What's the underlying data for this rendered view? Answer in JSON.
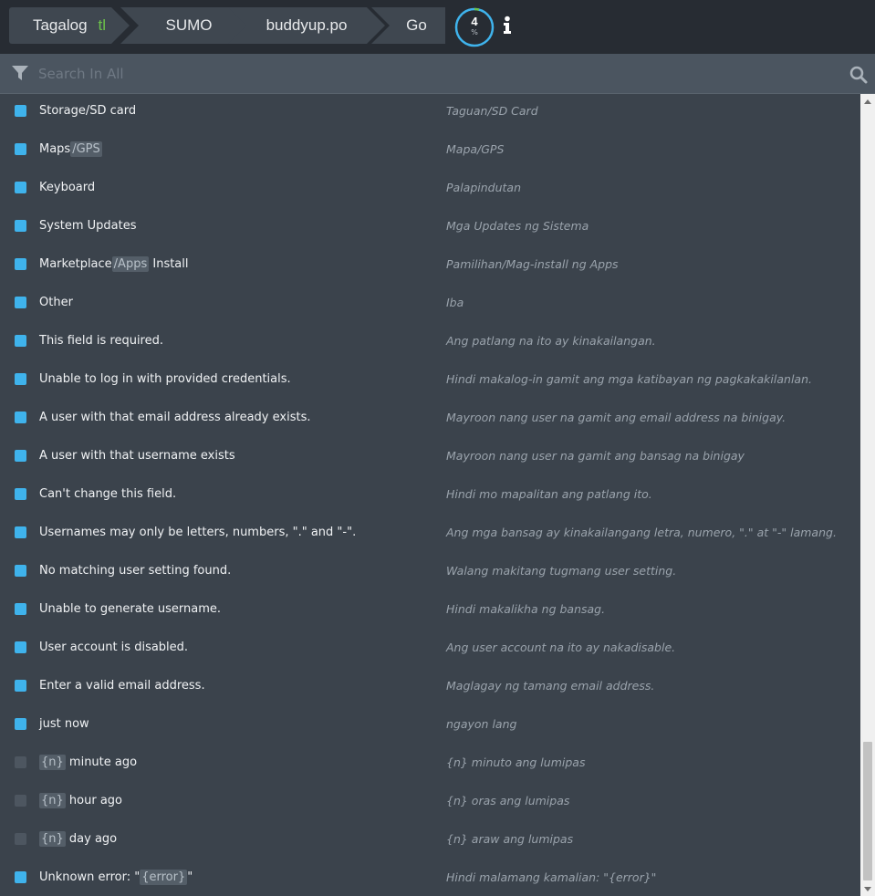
{
  "breadcrumb": {
    "language": "Tagalog",
    "language_code": "tl",
    "project": "SUMO",
    "file": "buddyup.po",
    "go_label": "Go"
  },
  "progress": {
    "value": "4",
    "unit": "%",
    "accent_color": "#3fb3ec"
  },
  "search": {
    "placeholder": "Search In All"
  },
  "rows": [
    {
      "source": [
        {
          "t": "Storage/SD card"
        }
      ],
      "target": "Taguan/SD Card",
      "checked": true
    },
    {
      "source": [
        {
          "t": "Maps"
        },
        {
          "t": "/GPS",
          "ph": true
        }
      ],
      "target": "Mapa/GPS",
      "checked": true
    },
    {
      "source": [
        {
          "t": "Keyboard"
        }
      ],
      "target": "Palapindutan",
      "checked": true
    },
    {
      "source": [
        {
          "t": "System Updates"
        }
      ],
      "target": "Mga Updates ng Sistema",
      "checked": true
    },
    {
      "source": [
        {
          "t": "Marketplace"
        },
        {
          "t": "/Apps",
          "ph": true
        },
        {
          "t": " Install"
        }
      ],
      "target": "Pamilihan/Mag-install ng Apps",
      "checked": true
    },
    {
      "source": [
        {
          "t": "Other"
        }
      ],
      "target": "Iba",
      "checked": true
    },
    {
      "source": [
        {
          "t": "This field is required."
        }
      ],
      "target": "Ang patlang na ito ay kinakailangan.",
      "checked": true
    },
    {
      "source": [
        {
          "t": "Unable to log in with provided credentials."
        }
      ],
      "target": "Hindi makalog-in gamit ang mga katibayan ng pagkakakilanlan.",
      "checked": true
    },
    {
      "source": [
        {
          "t": "A user with that email address already exists."
        }
      ],
      "target": "Mayroon nang user na gamit ang email address na binigay.",
      "checked": true
    },
    {
      "source": [
        {
          "t": "A user with that username exists"
        }
      ],
      "target": "Mayroon nang user na gamit ang bansag na binigay",
      "checked": true
    },
    {
      "source": [
        {
          "t": "Can't change this field."
        }
      ],
      "target": "Hindi mo mapalitan ang patlang ito.",
      "checked": true
    },
    {
      "source": [
        {
          "t": "Usernames may only be letters, numbers, \".\" and \"-\"."
        }
      ],
      "target": "Ang mga bansag ay kinakailangang letra, numero, \".\" at \"-\" lamang.",
      "checked": true
    },
    {
      "source": [
        {
          "t": "No matching user setting found."
        }
      ],
      "target": "Walang makitang tugmang user setting.",
      "checked": true
    },
    {
      "source": [
        {
          "t": "Unable to generate username."
        }
      ],
      "target": "Hindi makalikha ng bansag.",
      "checked": true
    },
    {
      "source": [
        {
          "t": "User account is disabled."
        }
      ],
      "target": "Ang user account na ito ay nakadisable.",
      "checked": true
    },
    {
      "source": [
        {
          "t": "Enter a valid email address."
        }
      ],
      "target": "Maglagay ng tamang email address.",
      "checked": true
    },
    {
      "source": [
        {
          "t": "just now"
        }
      ],
      "target": "ngayon lang",
      "checked": true
    },
    {
      "source": [
        {
          "t": "{n}",
          "ph": true
        },
        {
          "t": " minute ago"
        }
      ],
      "target": "{n} minuto ang lumipas",
      "checked": false
    },
    {
      "source": [
        {
          "t": "{n}",
          "ph": true
        },
        {
          "t": " hour ago"
        }
      ],
      "target": "{n} oras ang lumipas",
      "checked": false
    },
    {
      "source": [
        {
          "t": "{n}",
          "ph": true
        },
        {
          "t": " day ago"
        }
      ],
      "target": "{n} araw ang lumipas",
      "checked": false
    },
    {
      "source": [
        {
          "t": "Unknown error: \""
        },
        {
          "t": "{error}",
          "ph": true
        },
        {
          "t": "\""
        }
      ],
      "target": "Hindi malamang kamalian: \"{error}\"",
      "checked": true
    }
  ]
}
